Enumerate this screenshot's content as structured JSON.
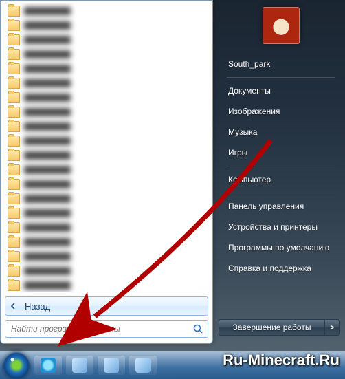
{
  "start_menu": {
    "back_label": "Назад",
    "search_placeholder": "Найти программы и файлы",
    "right_nav": {
      "user": "South_park",
      "items_group1": [
        "Документы",
        "Изображения",
        "Музыка",
        "Игры"
      ],
      "items_group2": [
        "Компьютер"
      ],
      "items_group3": [
        "Панель управления",
        "Устройства и принтеры",
        "Программы по умолчанию",
        "Справка и поддержка"
      ]
    },
    "shutdown_label": "Завершение работы"
  },
  "watermark": "Ru-Minecraft.Ru",
  "program_rows": 20
}
